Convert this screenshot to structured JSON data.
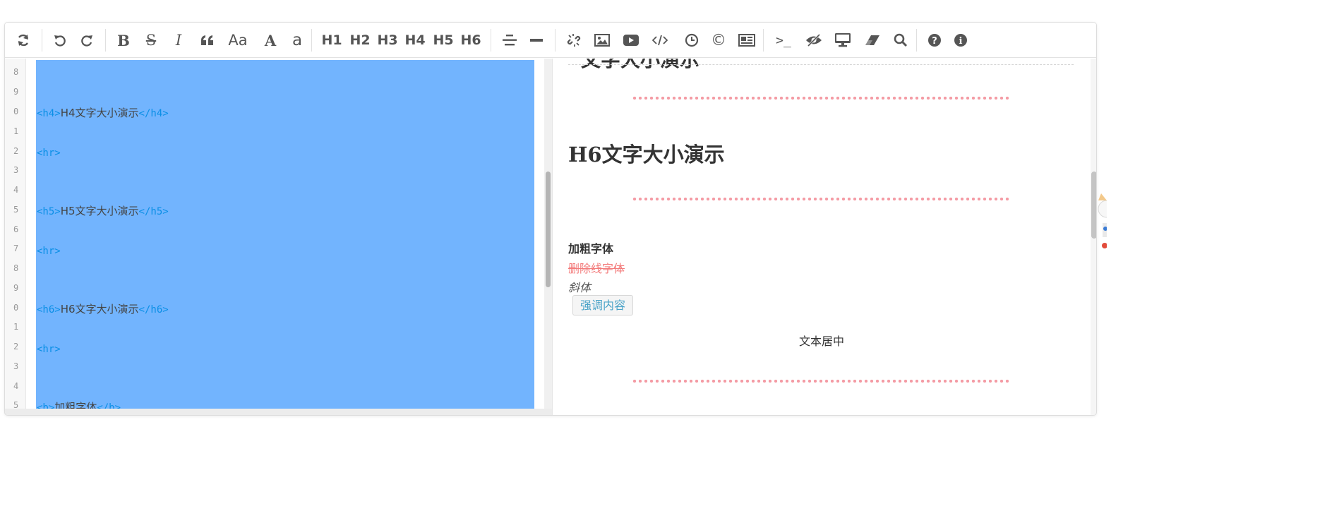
{
  "toolbar": {
    "buttons": [
      {
        "name": "refresh-icon",
        "label": "Refresh"
      },
      {
        "name": "undo-icon",
        "label": "Undo"
      },
      {
        "name": "redo-icon",
        "label": "Redo"
      },
      {
        "name": "bold-icon",
        "label": "B"
      },
      {
        "name": "strikethrough-icon",
        "label": "S"
      },
      {
        "name": "italic-icon",
        "label": "I"
      },
      {
        "name": "quote-icon",
        "label": "Quote"
      },
      {
        "name": "uppercase-icon",
        "label": "Aa"
      },
      {
        "name": "uppercase-A-icon",
        "label": "A"
      },
      {
        "name": "lowercase-a-icon",
        "label": "a"
      },
      {
        "name": "h1-button",
        "label": "H1"
      },
      {
        "name": "h2-button",
        "label": "H2"
      },
      {
        "name": "h3-button",
        "label": "H3"
      },
      {
        "name": "h4-button",
        "label": "H4"
      },
      {
        "name": "h5-button",
        "label": "H5"
      },
      {
        "name": "h6-button",
        "label": "H6"
      },
      {
        "name": "align-center-icon",
        "label": "Center"
      },
      {
        "name": "hr-icon",
        "label": "Horizontal rule"
      },
      {
        "name": "link-icon",
        "label": "Link"
      },
      {
        "name": "image-icon",
        "label": "Image"
      },
      {
        "name": "video-icon",
        "label": "Video"
      },
      {
        "name": "code-icon",
        "label": "Code"
      },
      {
        "name": "clock-icon",
        "label": "Datetime"
      },
      {
        "name": "copyright-icon",
        "label": "©"
      },
      {
        "name": "newspaper-icon",
        "label": "Template"
      },
      {
        "name": "terminal-icon",
        "label": ">_"
      },
      {
        "name": "eye-slash-icon",
        "label": "Hide preview"
      },
      {
        "name": "desktop-icon",
        "label": "Fullscreen"
      },
      {
        "name": "eraser-icon",
        "label": "Clear"
      },
      {
        "name": "search-icon",
        "label": "Search"
      },
      {
        "name": "help-icon",
        "label": "Help"
      },
      {
        "name": "info-icon",
        "label": "Info"
      }
    ]
  },
  "gutter": {
    "line_numbers": [
      "8",
      "9",
      "0",
      "1",
      "2",
      "3",
      "4",
      "5",
      "6",
      "7",
      "8",
      "9",
      "0",
      "1",
      "2",
      "3",
      "4",
      "5"
    ]
  },
  "code": {
    "lines": [
      {
        "open": "",
        "text": "",
        "close": ""
      },
      {
        "open": "",
        "text": "",
        "close": ""
      },
      {
        "open": "<h4>",
        "text": "H4文字大小演示",
        "close": "</h4>"
      },
      {
        "open": "",
        "text": "",
        "close": ""
      },
      {
        "open": "<hr>",
        "text": "",
        "close": ""
      },
      {
        "open": "",
        "text": "",
        "close": ""
      },
      {
        "open": "",
        "text": "",
        "close": ""
      },
      {
        "open": "<h5>",
        "text": "H5文字大小演示",
        "close": "</h5>"
      },
      {
        "open": "",
        "text": "",
        "close": ""
      },
      {
        "open": "<hr>",
        "text": "",
        "close": ""
      },
      {
        "open": "",
        "text": "",
        "close": ""
      },
      {
        "open": "",
        "text": "",
        "close": ""
      },
      {
        "open": "<h6>",
        "text": "H6文字大小演示",
        "close": "</h6>"
      },
      {
        "open": "",
        "text": "",
        "close": ""
      },
      {
        "open": "<hr>",
        "text": "",
        "close": ""
      },
      {
        "open": "",
        "text": "",
        "close": ""
      },
      {
        "open": "",
        "text": "",
        "close": ""
      },
      {
        "open": "<b>",
        "text": "加粗字体",
        "close": "</b>"
      }
    ]
  },
  "preview": {
    "peek_title": "文字大小演示",
    "h6_title": "H6文字大小演示",
    "bold_text": "加粗字体",
    "strike_text": "删除线字体",
    "italic_text": "斜体",
    "emphasis_text": "强调内容",
    "center_text": "文本居中"
  },
  "colors": {
    "selection": "#72b4fe",
    "tag": "#0a8fe6",
    "dots": "#f49ba4",
    "strike": "#f37b7b",
    "emphasis": "#4aa3c8"
  }
}
